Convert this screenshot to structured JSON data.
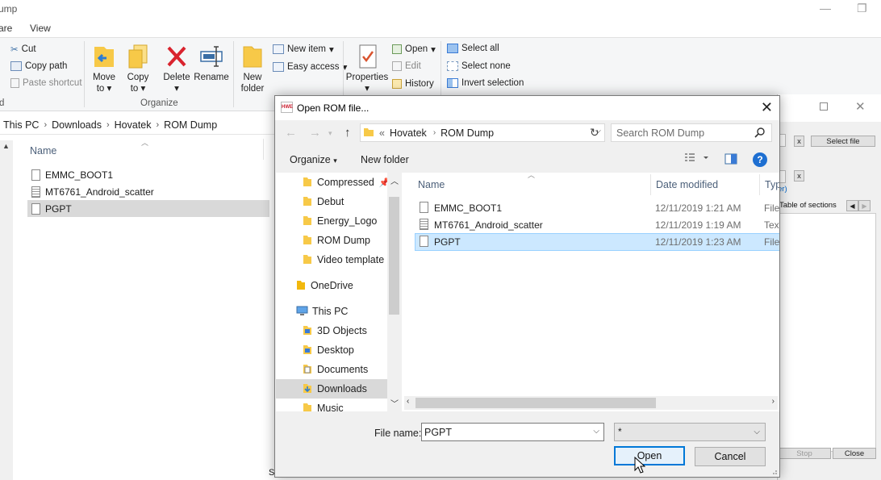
{
  "explorer": {
    "title_fragment": "ump",
    "tabs": [
      "are",
      "View"
    ],
    "ribbon": {
      "clipboard": {
        "cut": "Cut",
        "copy_path": "Copy path",
        "paste_shortcut": "Paste shortcut"
      },
      "organize": {
        "move_to": "Move",
        "move_to_2": "to",
        "copy_to": "Copy",
        "copy_to_2": "to",
        "delete": "Delete",
        "rename": "Rename",
        "group": "Organize"
      },
      "new": {
        "new_folder": "New",
        "new_folder_2": "folder",
        "new_item": "New item",
        "easy_access": "Easy access"
      },
      "open": {
        "properties": "Properties",
        "open": "Open",
        "edit": "Edit",
        "history": "History"
      },
      "select": {
        "select_all": "Select all",
        "select_none": "Select none",
        "invert": "Invert selection"
      },
      "group_left_fragment": "d"
    },
    "breadcrumb": [
      "This PC",
      "Downloads",
      "Hovatek",
      "ROM Dump"
    ],
    "column_name": "Name",
    "files": [
      "EMMC_BOOT1",
      "MT6761_Android_scatter",
      "PGPT"
    ],
    "selected_file": "PGPT",
    "bottom_fragment": "S"
  },
  "tool_window": {
    "select_file": "Select file",
    "x1": "x",
    "x2": "x",
    "link_fragment": "er)",
    "table_of_sections": "Table of sections",
    "stop": "Stop",
    "close": "Close"
  },
  "dialog": {
    "icon_text": "HWE",
    "title": "Open ROM file...",
    "close_label": "✕",
    "path": [
      "Hovatek",
      "ROM Dump"
    ],
    "path_prefix": "«",
    "search_placeholder": "Search ROM Dump",
    "organize": "Organize",
    "new_folder": "New folder",
    "help": "?",
    "nav": [
      {
        "label": "Compressed",
        "pinned": true
      },
      {
        "label": "Debut"
      },
      {
        "label": "Energy_Logo"
      },
      {
        "label": "ROM Dump"
      },
      {
        "label": "Video template"
      },
      {
        "label": "OneDrive"
      },
      {
        "label": "This PC"
      },
      {
        "label": "3D Objects"
      },
      {
        "label": "Desktop"
      },
      {
        "label": "Documents"
      },
      {
        "label": "Downloads"
      },
      {
        "label": "Music"
      }
    ],
    "columns": {
      "name": "Name",
      "date": "Date modified",
      "type": "Typ"
    },
    "files": [
      {
        "name": "EMMC_BOOT1",
        "date": "12/11/2019 1:21 AM",
        "type": "File"
      },
      {
        "name": "MT6761_Android_scatter",
        "date": "12/11/2019 1:19 AM",
        "type": "Text"
      },
      {
        "name": "PGPT",
        "date": "12/11/2019 1:23 AM",
        "type": "File"
      }
    ],
    "file_name_label": "File name:",
    "file_name_value": "PGPT",
    "filter_value": "*",
    "open_button": "Open",
    "cancel_button": "Cancel"
  },
  "colors": {
    "accent": "#0078d7",
    "selection": "#cce8ff",
    "folder": "#f7c948",
    "delete_red": "#d9232e"
  }
}
